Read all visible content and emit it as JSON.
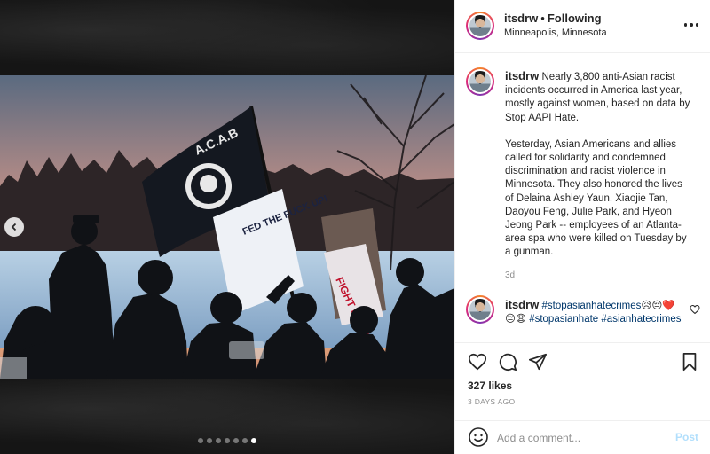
{
  "post": {
    "username": "itsdrw",
    "follow_status": "Following",
    "location": "Minneapolis, Minnesota",
    "caption": {
      "paragraphs": [
        "Nearly 3,800 anti-Asian racist incidents occurred in America last year, mostly against women, based on data by Stop AAPI Hate.",
        "Yesterday, Asian Americans and allies called for solidarity and condemned discrimination and racist violence in Minnesota. They also honored the lives of Delaina Ashley Yaun, Xiaojie Tan, Daoyou Feng, Julie Park, and Hyeon Jeong Park -- employees of an Atlanta-area spa who were killed on Tuesday by a gunman."
      ],
      "time": "3d"
    },
    "comment": {
      "username": "itsdrw",
      "hashtag1": "#stopasianhatecrimes",
      "emojis": "😥😔❤️😔😩",
      "hashtag2": "#stopasianhate",
      "hashtag3": "#asianhatecrimes"
    },
    "likes": "327 likes",
    "date": "3 DAYS AGO",
    "photo": {
      "flag_text": "A.C.A.B",
      "sign_left": "FED THE FUCK UP!",
      "sign_right": "FIGHT RACISM"
    },
    "carousel": {
      "count": 7,
      "active": 6
    }
  },
  "comment_box": {
    "placeholder": "Add a comment...",
    "post_label": "Post"
  },
  "icons": {
    "more": "more-options-icon",
    "heart": "heart-icon",
    "comment": "comment-icon",
    "share": "share-icon",
    "save": "bookmark-icon",
    "emoji": "emoji-icon",
    "prev": "chevron-left-icon"
  },
  "colors": {
    "link": "#00376b",
    "post_disabled": "#b2dffc",
    "muted": "#8e8e8e"
  }
}
